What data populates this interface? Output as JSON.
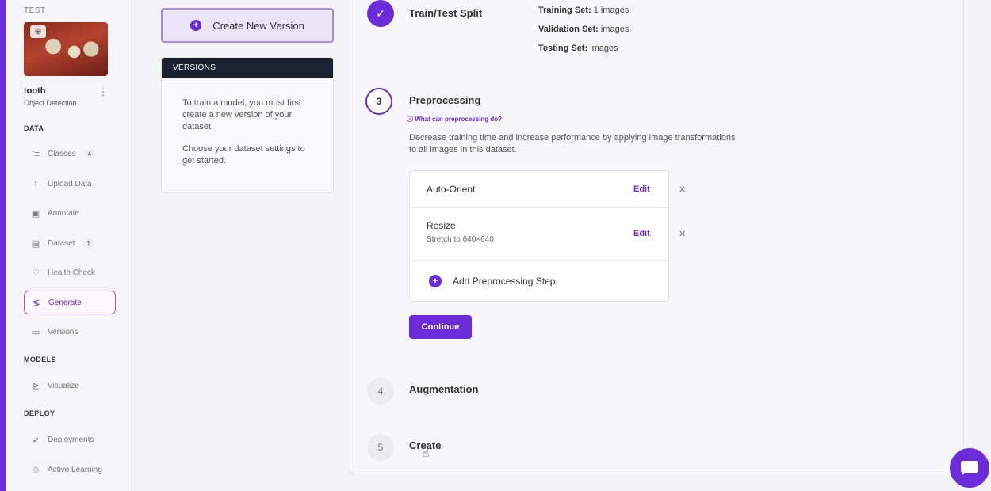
{
  "sidebar": {
    "project_label": "TEST",
    "project_name": "tooth",
    "project_type": "Object Detection",
    "sections": {
      "data": "DATA",
      "models": "MODELS",
      "deploy": "DEPLOY"
    },
    "items": [
      {
        "label": "Classes",
        "badge": "4",
        "icon": "list-icon"
      },
      {
        "label": "Upload Data",
        "icon": "upload-arrow-icon"
      },
      {
        "label": "Annotate",
        "icon": "annotate-icon"
      },
      {
        "label": "Dataset",
        "badge": "1",
        "icon": "images-icon"
      },
      {
        "label": "Health Check",
        "icon": "heart-icon"
      },
      {
        "label": "Generate",
        "icon": "generate-icon",
        "active": true
      },
      {
        "label": "Versions",
        "icon": "versions-icon"
      },
      {
        "label": "Visualize",
        "icon": "chart-icon"
      },
      {
        "label": "Deployments",
        "icon": "rocket-icon"
      },
      {
        "label": "Active Learning",
        "icon": "recycle-icon"
      }
    ]
  },
  "middle": {
    "create_button": "Create New Version",
    "versions_header": "VERSIONS",
    "versions_text_1": "To train a model, you must first create a new version of your dataset.",
    "versions_text_2": "Choose your dataset settings to get started."
  },
  "steps": {
    "split": {
      "title": "Train/Test Split",
      "training_label": "Training Set:",
      "training_value": "1 images",
      "validation_label": "Validation Set:",
      "validation_value": "images",
      "testing_label": "Testing Set:",
      "testing_value": "images"
    },
    "preprocessing": {
      "number": "3",
      "title": "Preprocessing",
      "help": "What can preprocessing do?",
      "description": "Decrease training time and increase performance by applying image transformations to all images in this dataset.",
      "items": [
        {
          "name": "Auto-Orient",
          "edit": "Edit"
        },
        {
          "name": "Resize",
          "sub": "Stretch to 640×640",
          "edit": "Edit"
        }
      ],
      "add_step": "Add Preprocessing Step",
      "continue": "Continue"
    },
    "augmentation": {
      "number": "4",
      "title": "Augmentation"
    },
    "create": {
      "number": "5",
      "title": "Create"
    }
  },
  "colors": {
    "accent": "#6c2bd9",
    "dark_header": "#1b2130"
  }
}
